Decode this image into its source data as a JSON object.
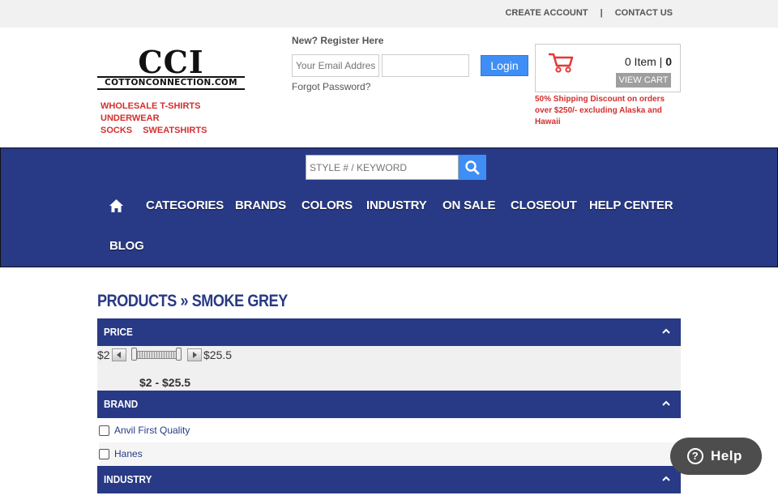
{
  "topbar": {
    "create_account": "CREATE ACCOUNT",
    "separator": "|",
    "contact_us": "CONTACT US"
  },
  "logo": {
    "mark": "CCI",
    "url": "COTTONCONNECTION.COM"
  },
  "category_links": [
    "WHOLESALE T-SHIRTS",
    "UNDERWEAR",
    "SOCKS",
    "SWEATSHIRTS"
  ],
  "login": {
    "register": "New? Register Here",
    "email_placeholder": "Your Email Address",
    "password_placeholder": "",
    "button": "Login",
    "forgot": "Forgot Password?"
  },
  "cart": {
    "count_text": "0 Item | ",
    "total": "0",
    "view_button": "VIEW CART",
    "icon": "shopping-cart-icon"
  },
  "promo": "50% Shipping Discount on orders over $250/- excluding Alaska and Hawaii",
  "search": {
    "placeholder": "STYLE # / KEYWORD",
    "icon": "search-icon"
  },
  "nav": {
    "home_icon": "home-icon",
    "items": [
      "CATEGORIES",
      "BRANDS",
      "COLORS",
      "INDUSTRY",
      "ON SALE",
      "CLOSEOUT",
      "HELP CENTER",
      "BLOG"
    ]
  },
  "page_title": "PRODUCTS » SMOKE GREY",
  "filters": {
    "price": {
      "label": "PRICE",
      "min": "$2",
      "max": "$25.5",
      "range": "$2 - $25.5"
    },
    "brand": {
      "label": "BRAND",
      "options": [
        "Anvil First Quality",
        "Hanes"
      ]
    },
    "industry": {
      "label": "INDUSTRY"
    }
  },
  "help_widget": {
    "label": "Help",
    "icon": "question-icon"
  },
  "colors": {
    "nav_blue": "#283a85",
    "button_blue": "#3f8ef5",
    "accent_red": "#d32f2f"
  }
}
